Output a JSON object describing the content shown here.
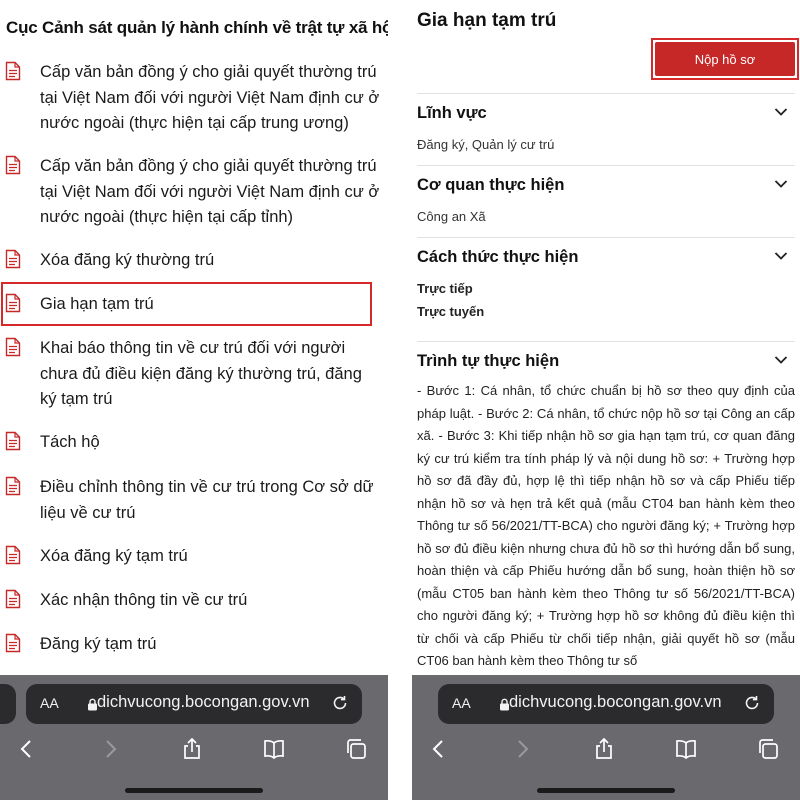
{
  "left": {
    "agency_title": "Cục Cảnh sát quản lý hành chính về trật tự xã hội",
    "procedures": [
      {
        "label": "Cấp văn bản đồng ý cho giải quyết thường trú tại Việt Nam đối với người Việt Nam định cư ở nước ngoài (thực hiện tại cấp trung ương)"
      },
      {
        "label": "Cấp văn bản đồng ý cho giải quyết thường trú tại Việt Nam đối với người Việt Nam định cư ở nước ngoài (thực hiện tại cấp tỉnh)"
      },
      {
        "label": "Xóa đăng ký thường trú"
      },
      {
        "label": "Gia hạn tạm trú",
        "highlighted": true
      },
      {
        "label": "Khai báo thông tin về cư trú đối với người chưa đủ điều kiện đăng ký thường trú, đăng ký tạm trú"
      },
      {
        "label": "Tách hộ"
      },
      {
        "label": "Điều chỉnh thông tin về cư trú trong Cơ sở dữ liệu về cư trú"
      },
      {
        "label": "Xóa đăng ký tạm trú"
      },
      {
        "label": "Xác nhận thông tin về cư trú"
      },
      {
        "label": "Đăng ký tạm trú"
      }
    ]
  },
  "right": {
    "title": "Gia hạn tạm trú",
    "submit_label": "Nộp hồ sơ",
    "sections": [
      {
        "heading": "Lĩnh vực",
        "values": [
          "Đăng ký, Quản lý cư trú"
        ]
      },
      {
        "heading": "Cơ quan thực hiện",
        "values": [
          "Công an Xã"
        ]
      },
      {
        "heading": "Cách thức thực hiện",
        "values": [
          "Trực tiếp",
          "Trực tuyến"
        ]
      },
      {
        "heading": "Trình tự thực hiện",
        "values": []
      }
    ],
    "steps_text": "- Bước 1: Cá nhân, tổ chức chuẩn bị hồ sơ theo quy định của pháp luật. - Bước 2: Cá nhân, tổ chức nộp hồ sơ tại Công an cấp xã. - Bước 3: Khi tiếp nhận hồ sơ gia hạn tạm trú, cơ quan đăng ký cư trú kiểm tra tính pháp lý và nội dung hồ sơ: + Trường hợp hồ sơ đã đầy đủ, hợp lệ thì tiếp nhận hồ sơ và cấp Phiếu tiếp nhận hồ sơ và hẹn trả kết quả (mẫu CT04 ban hành kèm theo Thông tư số 56/2021/TT-BCA) cho người đăng ký; + Trường hợp hồ sơ đủ điều kiện nhưng chưa đủ hồ sơ thì hướng dẫn bổ sung, hoàn thiện và cấp Phiếu hướng dẫn bổ sung, hoàn thiện hồ sơ (mẫu CT05 ban hành kèm theo Thông tư số 56/2021/TT-BCA) cho người đăng ký; + Trường hợp hồ sơ không đủ điều kiện thì từ chối và cấp Phiếu từ chối tiếp nhận, giải quyết hồ sơ (mẫu CT06 ban hành kèm theo Thông tư số"
  },
  "browser": {
    "text_size_label": "AA",
    "url": "dichvucong.bocongan.gov.vn",
    "icons": [
      "lock-icon",
      "reload-icon",
      "back-icon",
      "forward-icon",
      "share-icon",
      "bookmarks-icon",
      "tabs-icon"
    ]
  },
  "colors": {
    "accent": "#c62828",
    "highlight_border": "#d62a2a",
    "chrome": "#6a6a6e",
    "url_bar": "#2b2b2d"
  }
}
